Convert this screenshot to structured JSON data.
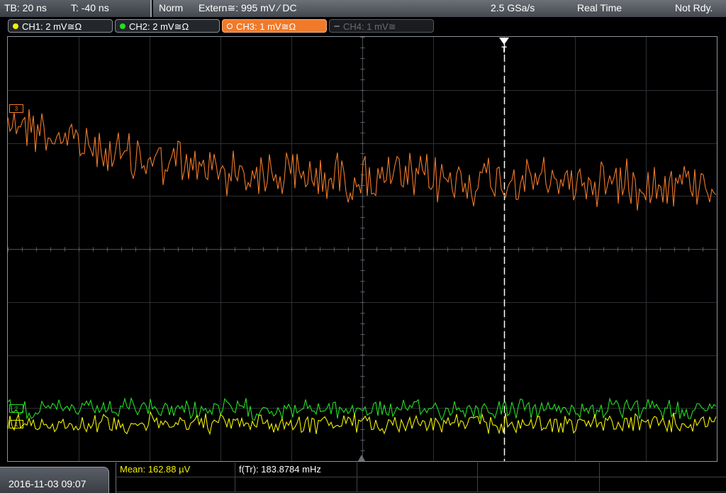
{
  "status": {
    "timebase": "TB: 20 ns",
    "trigger_offset": "T: -40 ns",
    "mode": "Norm",
    "trigger_source": "Extern≅: 995 mV ⁄ DC",
    "sample_rate": "2.5 GSa/s",
    "acq_mode": "Real Time",
    "ready_state": "Not Rdy."
  },
  "channels": [
    {
      "label": "CH1: 2 mV≅Ω",
      "color": "#f2f200",
      "state": "on"
    },
    {
      "label": "CH2: 2 mV≅Ω",
      "color": "#22e022",
      "state": "on"
    },
    {
      "label": "CH3: 1 mV≅Ω",
      "color": "#f07a2a",
      "state": "active"
    },
    {
      "label": "CH4: 1 mV≅",
      "color": "#686c72",
      "state": "off"
    }
  ],
  "screen": {
    "trigger_marker": "T",
    "level_markers": [
      {
        "channel": "CH3",
        "text": "3"
      },
      {
        "channel": "CH2",
        "text": "2"
      },
      {
        "channel": "CH1",
        "text": "1"
      }
    ]
  },
  "footer": {
    "datetime": "2016-11-03 09:07",
    "measurements": [
      {
        "label": "Mean: 162.88 µV",
        "color": "#f2f200"
      },
      {
        "label": "f(Tr): 183.8784 mHz",
        "color": "#ffffff"
      }
    ]
  }
}
